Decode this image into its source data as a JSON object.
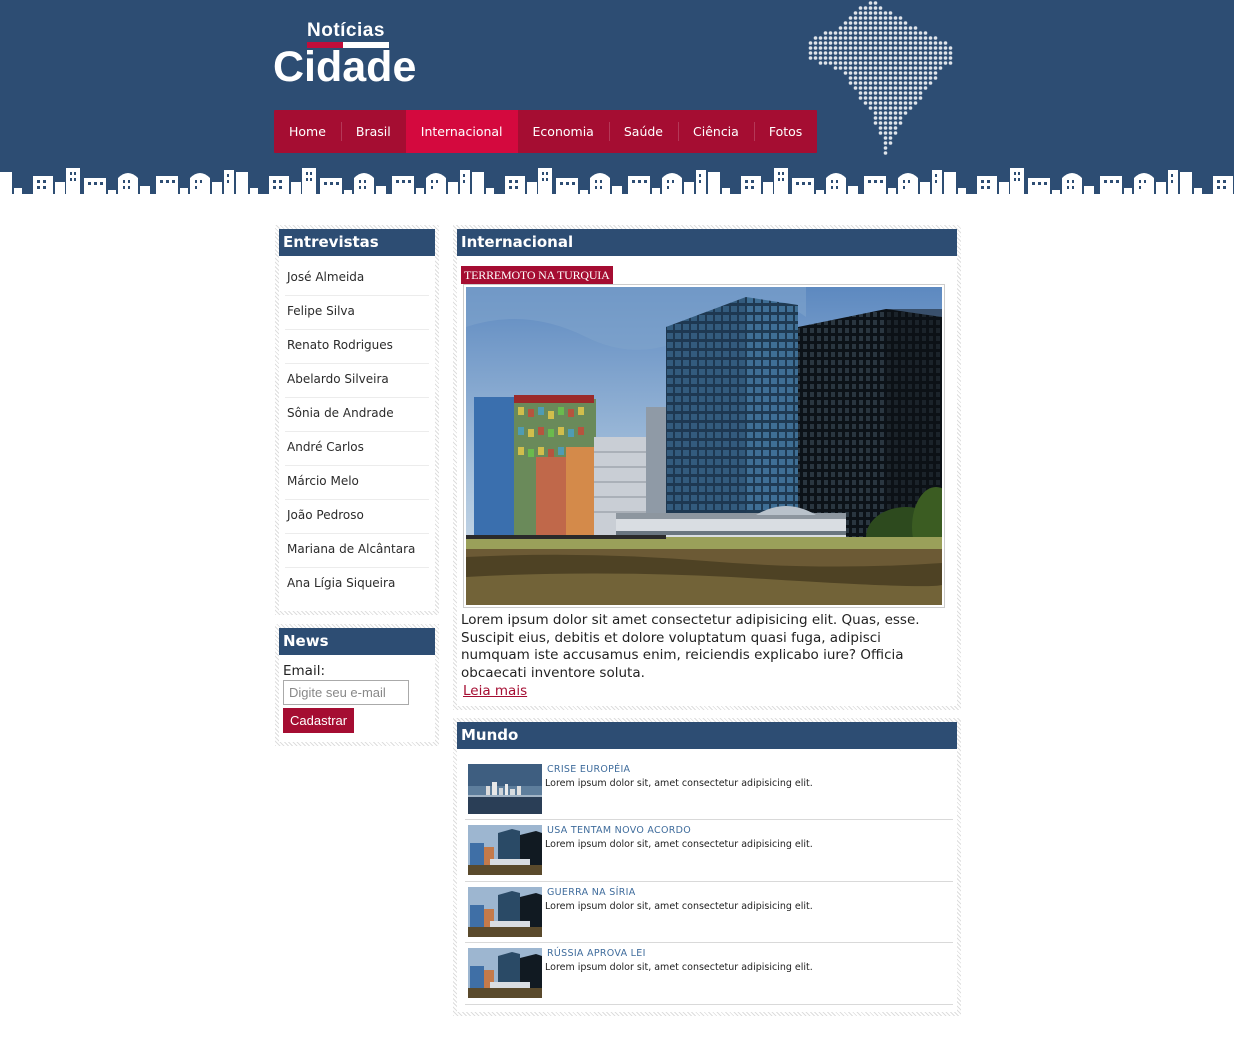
{
  "logo": {
    "top": "Notícias",
    "main": "Cidade"
  },
  "nav": {
    "items": [
      {
        "label": "Home",
        "active": false
      },
      {
        "label": "Brasil",
        "active": false
      },
      {
        "label": "Internacional",
        "active": true
      },
      {
        "label": "Economia",
        "active": false
      },
      {
        "label": "Saúde",
        "active": false
      },
      {
        "label": "Ciência",
        "active": false
      },
      {
        "label": "Fotos",
        "active": false
      }
    ]
  },
  "sidebar": {
    "interviews_title": "Entrevistas",
    "interviews": [
      "José Almeida",
      "Felipe Silva",
      "Renato Rodrigues",
      "Abelardo Silveira",
      "Sônia de Andrade",
      "André Carlos",
      "Márcio Melo",
      "João Pedroso",
      "Mariana de Alcântara",
      "Ana Lígia Siqueira"
    ],
    "news_title": "News",
    "email_label": "Email:",
    "email_placeholder": "Digite seu e-mail",
    "email_value": "",
    "submit_label": "Cadastrar"
  },
  "international": {
    "title": "Internacional",
    "badge": "TERREMOTO NA TURQUIA",
    "lead": "Lorem ipsum dolor sit amet consectetur adipisicing elit. Quas, esse. Suscipit eius, debitis et dolore voluptatum quasi fuga, adipisci numquam iste accusamus enim, reiciendis explicabo iure? Officia obcaecati inventore soluta.",
    "read_more": "Leia mais"
  },
  "world": {
    "title": "Mundo",
    "items": [
      {
        "title": "CRISE EUROPÉIA",
        "text": "Lorem ipsum dolor sit, amet consectetur adipisicing elit.",
        "thumb": "city-skyline-water"
      },
      {
        "title": "USA TENTAM NOVO ACORDO",
        "text": "Lorem ipsum dolor sit, amet consectetur adipisicing elit.",
        "thumb": "modern-towers"
      },
      {
        "title": "GUERRA NA SÍRIA",
        "text": "Lorem ipsum dolor sit, amet consectetur adipisicing elit.",
        "thumb": "modern-towers"
      },
      {
        "title": "RÚSSIA APROVA LEI",
        "text": "Lorem ipsum dolor sit, amet consectetur adipisicing elit.",
        "thumb": "modern-towers"
      }
    ]
  },
  "colors": {
    "header_bg": "#2d4d73",
    "nav_bg": "#a50d32",
    "nav_active": "#d4093e",
    "accent_link": "#3f6c9c"
  }
}
